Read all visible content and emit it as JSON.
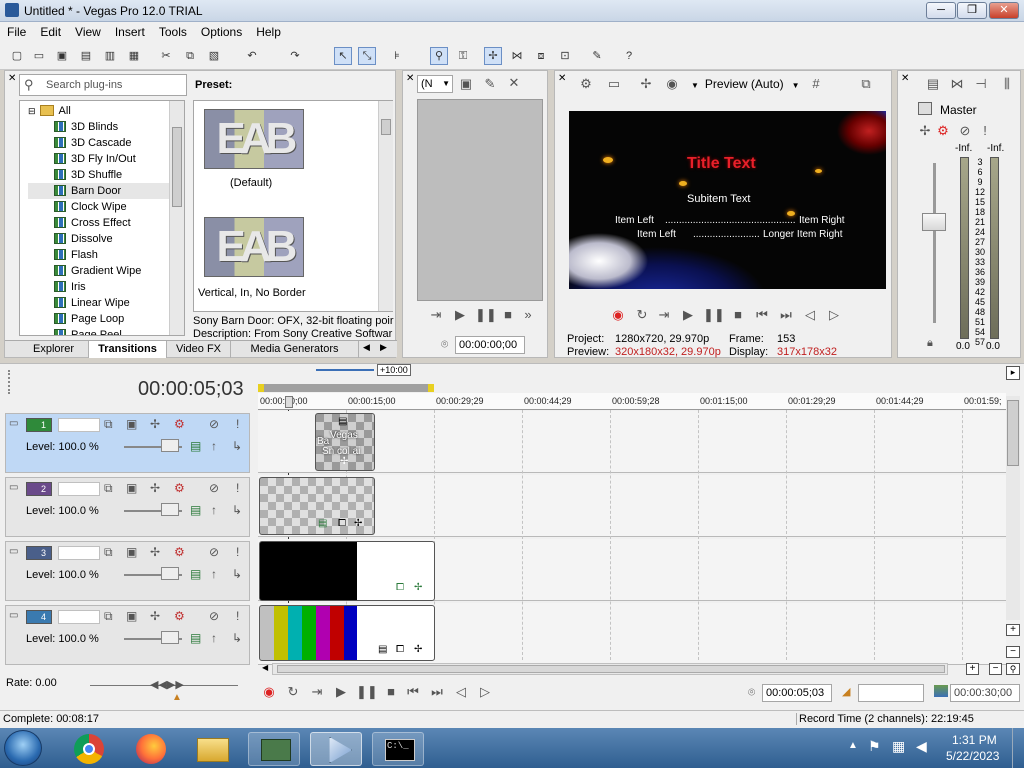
{
  "window": {
    "title": "Untitled * - Vegas Pro 12.0 TRIAL"
  },
  "menu": [
    "File",
    "Edit",
    "View",
    "Insert",
    "Tools",
    "Options",
    "Help"
  ],
  "plugins": {
    "search_placeholder": "Search plug-ins",
    "tree_root": "All",
    "tree_items": [
      "3D Blinds",
      "3D Cascade",
      "3D Fly In/Out",
      "3D Shuffle",
      "Barn Door",
      "Clock Wipe",
      "Cross Effect",
      "Dissolve",
      "Flash",
      "Gradient Wipe",
      "Iris",
      "Linear Wipe",
      "Page Loop",
      "Page Peel"
    ],
    "preset_label": "Preset:",
    "presets": [
      "(Default)",
      "Vertical, In, No Border"
    ],
    "desc_line1": "Sony Barn Door: OFX, 32-bit floating poir",
    "desc_line2": "Description: From Sony Creative Softwar",
    "tabs": [
      "Explorer",
      "Transitions",
      "Video FX",
      "Media Generators"
    ],
    "active_tab": "Transitions"
  },
  "trimmer": {
    "dropdown": "(N",
    "time": "00:00:00;00"
  },
  "preview": {
    "mode": "Preview (Auto)",
    "title_text": "Title Text",
    "subitem": "Subitem Text",
    "line1_left": "Item Left",
    "line1_right": "Item Right",
    "line2_left": "Item Left",
    "line2_right": "Longer Item Right",
    "project_label": "Project:",
    "project_value": "1280x720, 29.970p",
    "preview_label": "Preview:",
    "preview_value": "320x180x32, 29.970p",
    "frame_label": "Frame:",
    "frame_value": "153",
    "display_label": "Display:",
    "display_value": "317x178x32"
  },
  "mixer": {
    "master": "Master",
    "inf_left": "-Inf.",
    "inf_right": "-Inf.",
    "scale": [
      "3",
      "6",
      "9",
      "12",
      "15",
      "18",
      "21",
      "24",
      "27",
      "30",
      "33",
      "36",
      "39",
      "42",
      "45",
      "48",
      "51",
      "54",
      "57"
    ],
    "bottom_left": "0.0",
    "bottom_right": "0.0"
  },
  "timeline": {
    "current_time": "00:00:05;03",
    "zoom_marker": "+10:00",
    "ruler": [
      "00:00:00;00",
      "00:00:15;00",
      "00:00:29;29",
      "00:00:44;29",
      "00:00:59;28",
      "00:01:15;00",
      "00:01:29;29",
      "00:01:44;29",
      "00:01:59;"
    ],
    "tracks": [
      {
        "number": "1",
        "level": "Level: 100.0 %",
        "color": "#2f8a3a"
      },
      {
        "number": "2",
        "level": "Level: 100.0 %",
        "color": "#6a4a8a"
      },
      {
        "number": "3",
        "level": "Level: 100.0 %",
        "color": "#4a5f8a"
      },
      {
        "number": "4",
        "level": "Level: 100.0 %",
        "color": "#3a7ab0"
      }
    ],
    "clip1_text_a": "Vegas",
    "clip1_text_b": "Ba",
    "clip1_text_c": "Sn col ai"
  },
  "transport": {
    "rate": "Rate: 0.00",
    "cursor_time": "00:00:05;03",
    "end_time": "00:00:30;00"
  },
  "status": {
    "left": "Complete: 00:08:17",
    "right": "Record Time (2 channels): 22:19:45"
  },
  "taskbar": {
    "time": "1:31 PM",
    "date": "5/22/2023"
  },
  "colors": {
    "accent": "#3b6fb6",
    "selected_track": "#bfd8f5",
    "title_red": "#e8202a",
    "preview_value_red": "#c02020"
  }
}
